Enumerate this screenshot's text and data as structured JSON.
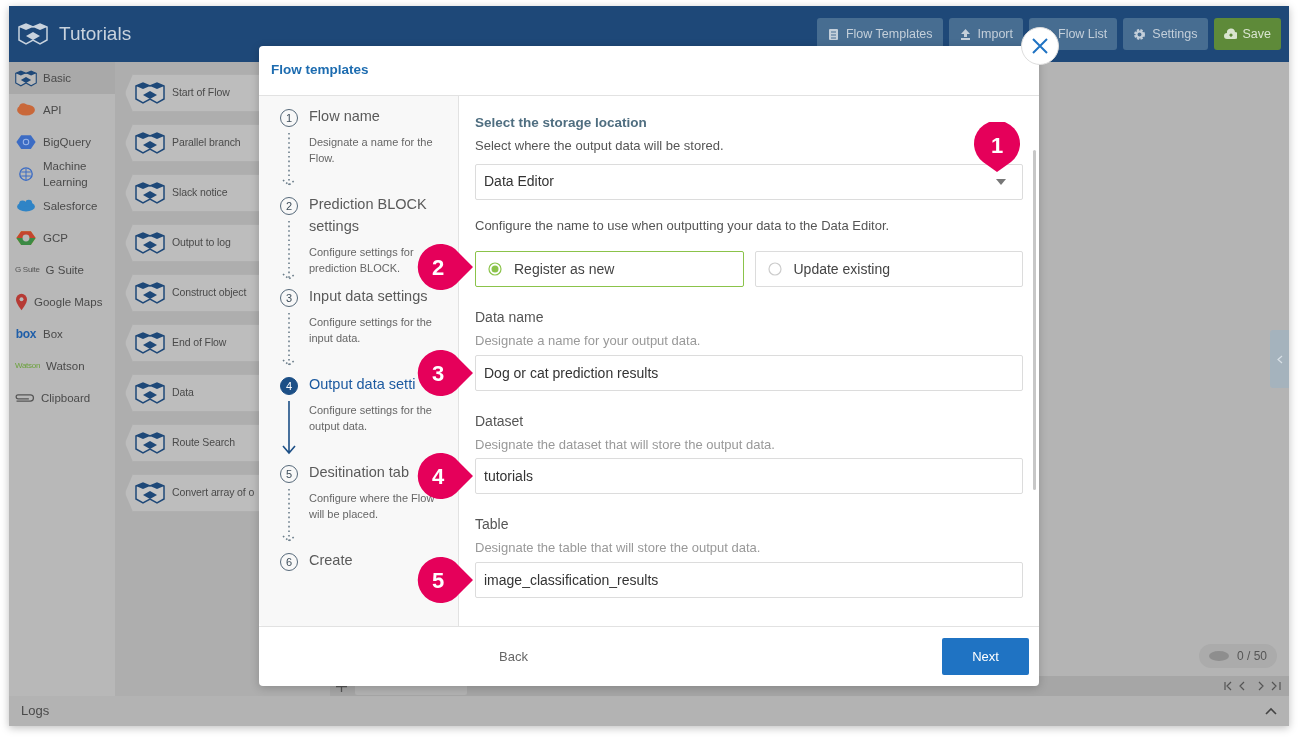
{
  "app": {
    "title": "Tutorials",
    "toolbar": [
      {
        "label": "Flow Templates",
        "kind": "primary"
      },
      {
        "label": "Import",
        "kind": "primary"
      },
      {
        "label": "Flow List",
        "kind": "primary"
      },
      {
        "label": "Settings",
        "kind": "primary"
      },
      {
        "label": "Save",
        "kind": "success"
      }
    ]
  },
  "categories": [
    {
      "label": "Basic",
      "selected": true
    },
    {
      "label": "API",
      "selected": false
    },
    {
      "label": "BigQuery",
      "selected": false
    },
    {
      "label": "Machine Learning",
      "selected": false
    },
    {
      "label": "Salesforce",
      "selected": false
    },
    {
      "label": "GCP",
      "selected": false
    },
    {
      "label": "G Suite",
      "logo_text": "G Suite",
      "selected": false
    },
    {
      "label": "Google Maps",
      "selected": false
    },
    {
      "label": "Box",
      "logo_text": "box",
      "selected": false
    },
    {
      "label": "Watson",
      "logo_text": "Watson",
      "selected": false
    },
    {
      "label": "Clipboard",
      "selected": false
    }
  ],
  "blocks": [
    "Start of Flow",
    "Parallel branch",
    "Slack notice",
    "Output to log",
    "Construct object",
    "End of Flow",
    "Data",
    "Route Search",
    "Convert array of o"
  ],
  "canvas": {
    "counter": "0 / 50"
  },
  "logs": {
    "label": "Logs"
  },
  "modal": {
    "title": "Flow templates",
    "steps": [
      {
        "number": "1",
        "title": "Flow name",
        "description": "Designate a name for the Flow.",
        "selected": false
      },
      {
        "number": "2",
        "title": "Prediction BLOCK settings",
        "description": "Configure settings for prediction BLOCK.",
        "selected": false
      },
      {
        "number": "3",
        "title": "Input data settings",
        "description": "Configure settings for the input data.",
        "selected": false
      },
      {
        "number": "4",
        "title": "Output data setti",
        "description": "Configure settings for the output data.",
        "selected": true
      },
      {
        "number": "5",
        "title": "Desitination tab",
        "description": "Configure where the Flow will be placed.",
        "selected": false
      },
      {
        "number": "6",
        "title": "Create",
        "selected": false
      }
    ],
    "section_title": "Select the storage location",
    "section_description": "Select where the output data will be stored.",
    "storage": {
      "value": "Data Editor",
      "callout": "1"
    },
    "configure_text": "Configure the name to use when outputting your data to the Data Editor.",
    "radios": {
      "callout": "2",
      "options": [
        {
          "label": "Register as new",
          "selected": true
        },
        {
          "label": "Update existing",
          "selected": false
        }
      ]
    },
    "fields": [
      {
        "label": "Data name",
        "hint": "Designate a name for your output data.",
        "value": "Dog or cat prediction results",
        "callout": "3"
      },
      {
        "label": "Dataset",
        "hint": "Designate the dataset that will store the output data.",
        "value": "tutorials",
        "callout": "4"
      },
      {
        "label": "Table",
        "hint": "Designate the table that will store the output data.",
        "value": "image_classification_results",
        "callout": "5"
      }
    ],
    "back": "Back",
    "next": "Next"
  }
}
